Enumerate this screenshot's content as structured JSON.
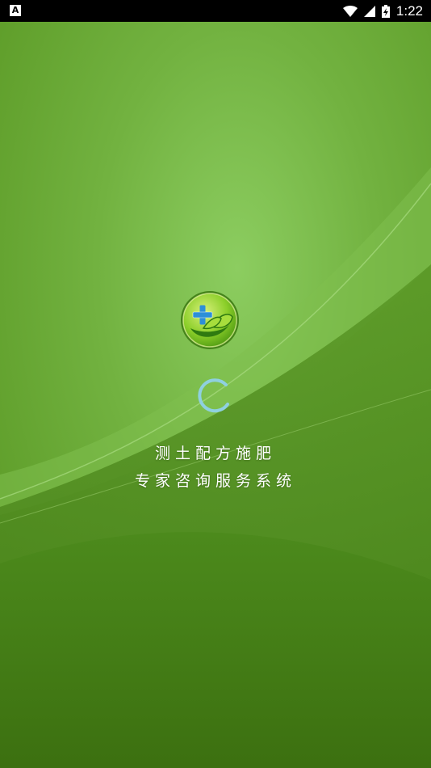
{
  "status_bar": {
    "notification_icon": "a-box-icon",
    "time": "1:22",
    "icons": [
      "wifi-icon",
      "cellular-signal-icon",
      "battery-charging-icon"
    ]
  },
  "splash": {
    "logo_icon": "plus-leaf-logo",
    "loading_indicator": "spinner",
    "tagline_line1": "测土配方施肥",
    "tagline_line2": "专家咨询服务系统"
  },
  "colors": {
    "bg_light": "#86c75a",
    "bg_mid": "#5f9e2a",
    "bg_dark": "#3f7612",
    "accent_blue": "#2d8fd8",
    "spinner": "#8fd0e0"
  }
}
